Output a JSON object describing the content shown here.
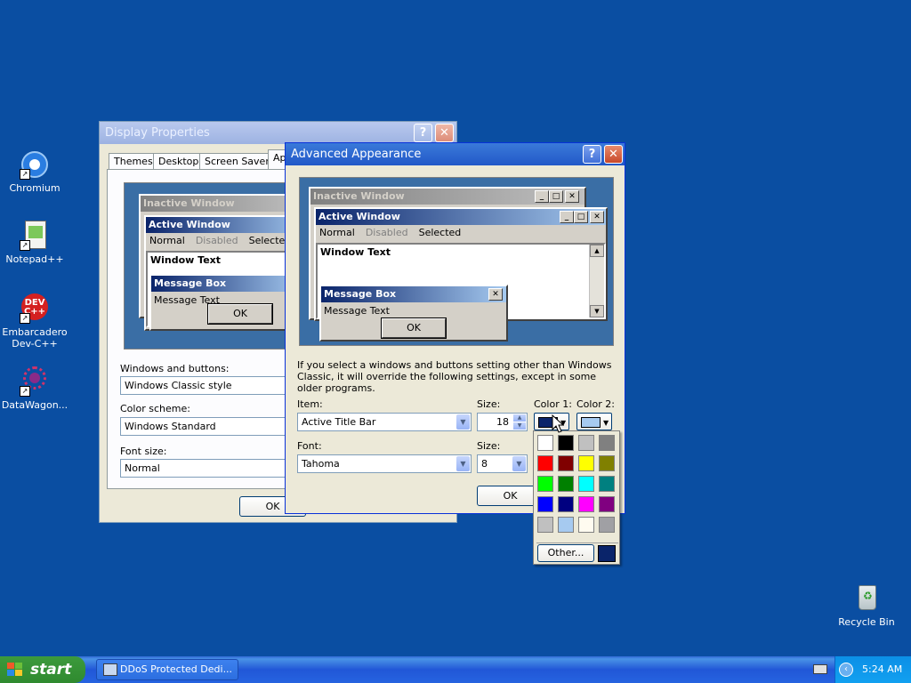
{
  "desktop": {
    "icons": [
      {
        "label": "Chromium"
      },
      {
        "label": "Notepad++"
      },
      {
        "label": "Embarcadero Dev-C++"
      },
      {
        "label": "DataWagon..."
      },
      {
        "label": "Recycle Bin"
      }
    ]
  },
  "display_properties": {
    "title": "Display Properties",
    "help": "?",
    "close": "✕",
    "tabs": [
      "Themes",
      "Desktop",
      "Screen Saver",
      "Ap"
    ],
    "preview": {
      "inactive_title": "Inactive Window",
      "active_title": "Active Window",
      "menu_normal": "Normal",
      "menu_disabled": "Disabled",
      "menu_selected": "Selected",
      "window_text": "Window Text",
      "message_box_title": "Message Box",
      "message_text": "Message Text",
      "ok": "OK"
    },
    "windows_buttons_label": "Windows and buttons:",
    "windows_buttons_value": "Windows Classic style",
    "color_scheme_label": "Color scheme:",
    "color_scheme_value": "Windows Standard",
    "font_size_label": "Font size:",
    "font_size_value": "Normal",
    "ok": "OK"
  },
  "advanced_appearance": {
    "title": "Advanced Appearance",
    "help": "?",
    "close": "✕",
    "preview": {
      "inactive_title": "Inactive Window",
      "active_title": "Active Window",
      "menu_normal": "Normal",
      "menu_disabled": "Disabled",
      "menu_selected": "Selected",
      "window_text": "Window Text",
      "message_box_title": "Message Box",
      "message_text": "Message Text",
      "ok": "OK"
    },
    "info_text": "If you select a windows and buttons setting other than Windows Classic, it will override the following settings, except in some older programs.",
    "item_label": "Item:",
    "item_value": "Active Title Bar",
    "size_label": "Size:",
    "size_value": "18",
    "color1_label": "Color 1:",
    "color2_label": "Color 2:",
    "font_label": "Font:",
    "font_value": "Tahoma",
    "font_size_label": "Size:",
    "font_size_value": "8",
    "ok": "OK",
    "color1": "#0a246a",
    "color2": "#a6caf0"
  },
  "palette": {
    "colors": [
      "#ffffff",
      "#000000",
      "#c0c0c0",
      "#808080",
      "#ff0000",
      "#800000",
      "#ffff00",
      "#808000",
      "#00ff00",
      "#008000",
      "#00ffff",
      "#008080",
      "#0000ff",
      "#000080",
      "#ff00ff",
      "#800080",
      "#c0c0c0",
      "#a6caf0",
      "#fffbf0",
      "#a0a0a4"
    ],
    "other_label": "Other...",
    "current": "#0a246a"
  },
  "taskbar": {
    "start_label": "start",
    "task_label": "DDoS Protected Dedi...",
    "clock": "5:24 AM"
  }
}
